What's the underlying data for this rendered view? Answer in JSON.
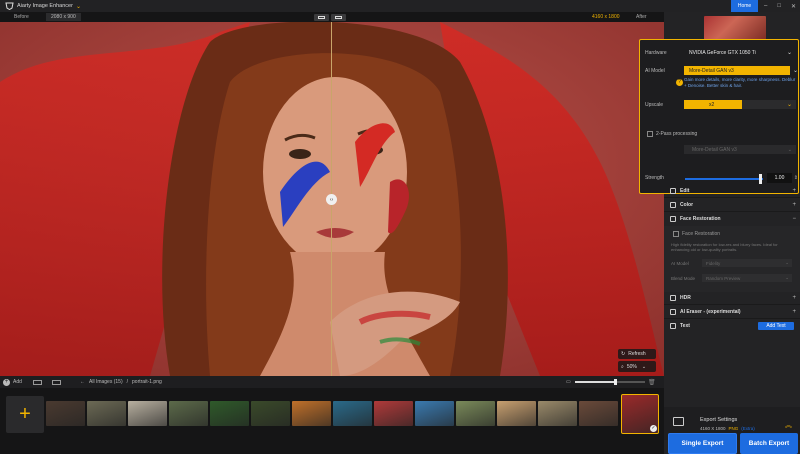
{
  "app": {
    "title": "Aiarty Image Enhancer",
    "home_tab": "Home"
  },
  "compare": {
    "before_label": "Before",
    "before_resolution": "2080 x 900",
    "after_resolution": "4160 x 1800",
    "after_label": "After"
  },
  "canvas": {
    "refresh_label": "Refresh",
    "zoom_value": "50%"
  },
  "bottom_bar": {
    "add_label": "Add",
    "crumb_root": "All Images (15)",
    "crumb_sep": "/",
    "crumb_file": "portrait-1.png",
    "zoom_slider_fraction": 0.58
  },
  "filmstrip": {
    "thumb_colors": [
      "#4a3a30",
      "#6c6a55",
      "#b8b0a0",
      "#5c6a4a",
      "#2f5a2a",
      "#3a4a2a",
      "#c0702a",
      "#2a6a8a",
      "#b03a3a",
      "#3a7ab0",
      "#7a8a5a",
      "#c8a070",
      "#9a8a6a",
      "#6a4a3a",
      "#9a2a2a"
    ],
    "selected_index": 14
  },
  "settings": {
    "hardware_label": "Hardware",
    "hardware_value": "NVIDIA GeForce GTX 1050 Ti",
    "model_label": "AI Model",
    "model_value": "More-Detail GAN v3",
    "model_hint": "Gain more details, more clarity, more sharpness. Deblur + Denoise. Better skin & hair.",
    "upscale_label": "Upscale",
    "upscale_value": "x2",
    "two_pass_label": "2-Pass processing",
    "two_pass_model": "More-Detail GAN v3",
    "strength_label": "Strength",
    "strength_value": "1.00",
    "strength_fraction": 1.0
  },
  "sections": {
    "edit": "Edit",
    "color": "Color",
    "face_restoration": "Face Restoration",
    "face_restoration_toggle": "Face Restoration",
    "face_desc": "High fidelity restoration for low-res and blurry faces. Ideal for enhancing old or low-quality portraits.",
    "face_model_label": "AI Model",
    "face_model_value": "Fidelity",
    "face_blend_label": "Blend Mode",
    "face_blend_value": "Random Preview",
    "hdr": "HDR",
    "ai_eraser": "AI Eraser - (experimental)",
    "text": "Text",
    "add_text": "Add Text"
  },
  "export": {
    "title": "Export Settings",
    "resolution": "4160 X 1800",
    "format": "PNG",
    "extra": "(Extra)",
    "single_label": "Single Export",
    "batch_label": "Batch Export"
  },
  "colors": {
    "accent_yellow": "#f2b400",
    "accent_blue": "#1d6ce0"
  }
}
